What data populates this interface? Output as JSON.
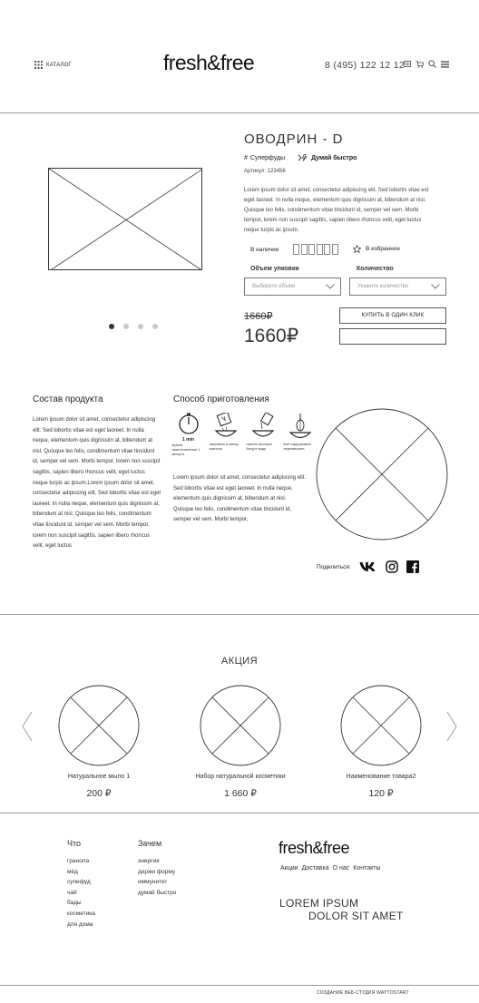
{
  "header": {
    "catalog_label": "КАТАЛОГ",
    "logo": "fresh&free",
    "phone": "8 (495) 122 12 12",
    "icons": [
      "user-icon",
      "cart-icon",
      "search-icon",
      "menu-icon"
    ]
  },
  "product": {
    "title": "ОВОДРИН - D",
    "tags": [
      "Суперфуды",
      "Думай быстро"
    ],
    "sku": "Артикул: 123456",
    "description": "Lorem ipsum dolor sit amet, consectetur adipiscing elit. Sed lobortis vitae est eget laoreet. In nulla neque, elementum quis dignissim at, bibendum at nisl. Quisque leo felis, condimentum vitae tincidunt id, semper vel sem. Morbi tempor, lorem non suscipit sagittis, sapien libero rhoncus velit, eget luctus neque turpis ac ipsum.",
    "availability": "В наличии",
    "favorite": "В избранное",
    "volume_label": "Объем упковки",
    "volume_placeholder": "Выберете объем",
    "quantity_label": "Количество",
    "quantity_placeholder": "Укажите количество",
    "old_price": "1660₽",
    "price": "1660₽",
    "buy_one_click": "КУПИТЬ В ОДИН КЛИК",
    "slider": {
      "count": 4,
      "active": 1
    }
  },
  "composition": {
    "title": "Состав продукта",
    "text": "Lorem ipsum dolor sit amet, consectetur adipiscing elit. Sed lobortis vitae est eget laoreet. In nulla neque, elementum quis dignissim at, bibendum at nisl. Quisque leo felis, condimentum vitae tincidunt id, semper vel sem. Morbi tempor, lorem non suscipit sagittis, sapien libero rhoncus velit, eget luctus neque turpis ac ipsum.Lorem ipsum dolor sit amet, consectetur adipiscing elit. Sed lobortis vitae est eget laoreet. In nulla neque, elementum quis dignissim at, bibendum at nisl. Quisque leo felis, condimentum vitae tincidunt id, semper vel sem. Morbi tempor, lorem non suscipit sagittis, sapien libero rhoncus velit, eget luctus"
  },
  "preparation": {
    "title": "Способ приготовления",
    "timer_label": "1 min",
    "steps": [
      {
        "icon": "timer-icon",
        "text": "время приготовления 1 минута"
      },
      {
        "icon": "scoop-icon",
        "text": "насыпать в миску гранолу"
      },
      {
        "icon": "pour-icon",
        "text": "налить молоко/йогурт воду"
      },
      {
        "icon": "whisk-icon",
        "text": "всё содержимое перемешать"
      }
    ],
    "text": "Lorem ipsum dolor sit amet, consectetur adipiscing elit. Sed lobortis vitae est eget laoreet. In nulla neque, elementum quis dignissim at, bibendum at nisl. Quisque leo felis, condimentum vitae tincidunt id, semper vel sem. Morbi tempor,"
  },
  "share": {
    "label": "Поделиться:",
    "icons": [
      "vk-icon",
      "instagram-icon",
      "facebook-icon"
    ]
  },
  "promo": {
    "title": "АКЦИЯ",
    "items": [
      {
        "name": "Натуральное мыло 1",
        "price": "200 ₽"
      },
      {
        "name": "Набор натуральной косметики",
        "price": "1 660 ₽"
      },
      {
        "name": "Наименование товара2",
        "price": "120 ₽"
      }
    ]
  },
  "footer": {
    "col1_title": "Что",
    "col1_items": [
      "гранола",
      "мёд",
      "супефуд",
      "чай",
      "бады",
      "косметика",
      "для дома"
    ],
    "col2_title": "Зачем",
    "col2_items": [
      "энергия",
      "держи форму",
      "иммунитет",
      "думай быстро"
    ],
    "logo": "fresh&free",
    "nav": [
      "Акции",
      "Доставка",
      "О нас",
      "Контакты"
    ],
    "slogan_line1": "LOREM IPSUM",
    "slogan_line2": "DOLOR SIT AMET",
    "credit": "СОЗДАНИЕ ВЕБ-СТУДИЯ WAYTOSTART"
  }
}
